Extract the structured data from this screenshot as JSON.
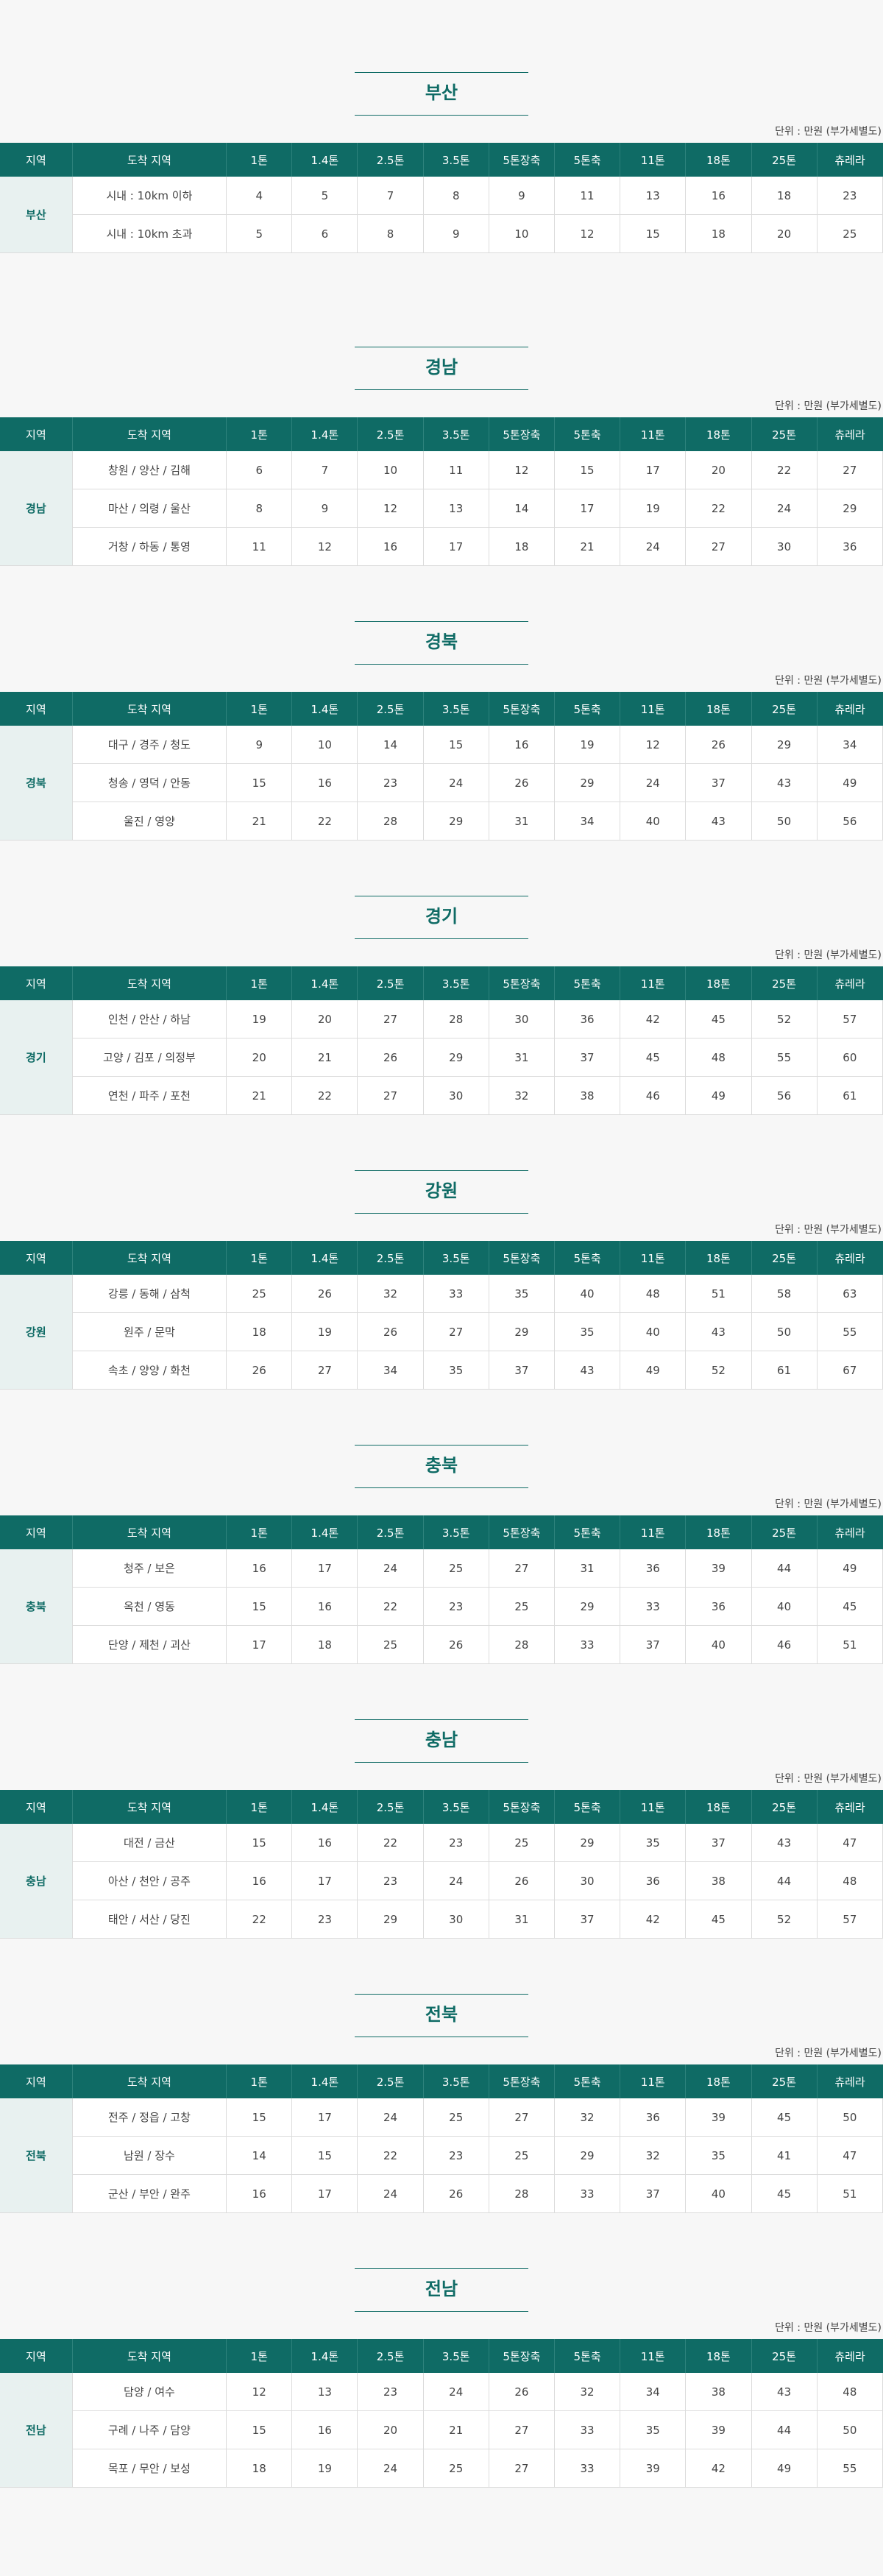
{
  "unit_label": "단위 : 만원 (부가세별도)",
  "headers": [
    "지역",
    "도착 지역",
    "1톤",
    "1.4톤",
    "2.5톤",
    "3.5톤",
    "5톤장축",
    "5톤축",
    "11톤",
    "18톤",
    "25톤",
    "츄레라"
  ],
  "sections": [
    {
      "title": "부산",
      "region": "부산",
      "rows": [
        {
          "dest": "시내 : 10km 이하",
          "values": [
            "4",
            "5",
            "7",
            "8",
            "9",
            "11",
            "13",
            "16",
            "18",
            "23"
          ]
        },
        {
          "dest": "시내 : 10km 초과",
          "values": [
            "5",
            "6",
            "8",
            "9",
            "10",
            "12",
            "15",
            "18",
            "20",
            "25"
          ]
        }
      ]
    },
    {
      "title": "경남",
      "region": "경남",
      "rows": [
        {
          "dest": "창원 / 양산 / 김해",
          "values": [
            "6",
            "7",
            "10",
            "11",
            "12",
            "15",
            "17",
            "20",
            "22",
            "27"
          ]
        },
        {
          "dest": "마산 / 의령 / 울산",
          "values": [
            "8",
            "9",
            "12",
            "13",
            "14",
            "17",
            "19",
            "22",
            "24",
            "29"
          ]
        },
        {
          "dest": "거창 / 하동 / 통영",
          "values": [
            "11",
            "12",
            "16",
            "17",
            "18",
            "21",
            "24",
            "27",
            "30",
            "36"
          ]
        }
      ]
    },
    {
      "title": "경북",
      "region": "경북",
      "rows": [
        {
          "dest": "대구 / 경주 / 청도",
          "values": [
            "9",
            "10",
            "14",
            "15",
            "16",
            "19",
            "12",
            "26",
            "29",
            "34"
          ]
        },
        {
          "dest": "청송 / 영덕 / 안동",
          "values": [
            "15",
            "16",
            "23",
            "24",
            "26",
            "29",
            "24",
            "37",
            "43",
            "49"
          ]
        },
        {
          "dest": "울진 / 영양",
          "values": [
            "21",
            "22",
            "28",
            "29",
            "31",
            "34",
            "40",
            "43",
            "50",
            "56"
          ]
        }
      ]
    },
    {
      "title": "경기",
      "region": "경기",
      "rows": [
        {
          "dest": "인천 / 안산 / 하남",
          "values": [
            "19",
            "20",
            "27",
            "28",
            "30",
            "36",
            "42",
            "45",
            "52",
            "57"
          ]
        },
        {
          "dest": "고양 / 김포 / 의정부",
          "values": [
            "20",
            "21",
            "26",
            "29",
            "31",
            "37",
            "45",
            "48",
            "55",
            "60"
          ]
        },
        {
          "dest": "연천 / 파주 / 포천",
          "values": [
            "21",
            "22",
            "27",
            "30",
            "32",
            "38",
            "46",
            "49",
            "56",
            "61"
          ]
        }
      ]
    },
    {
      "title": "강원",
      "region": "강원",
      "rows": [
        {
          "dest": "강릉 / 동해 / 삼척",
          "values": [
            "25",
            "26",
            "32",
            "33",
            "35",
            "40",
            "48",
            "51",
            "58",
            "63"
          ]
        },
        {
          "dest": "원주 / 문막",
          "values": [
            "18",
            "19",
            "26",
            "27",
            "29",
            "35",
            "40",
            "43",
            "50",
            "55"
          ]
        },
        {
          "dest": "속초 / 양양 / 화천",
          "values": [
            "26",
            "27",
            "34",
            "35",
            "37",
            "43",
            "49",
            "52",
            "61",
            "67"
          ]
        }
      ]
    },
    {
      "title": "충북",
      "region": "충북",
      "rows": [
        {
          "dest": "청주 / 보은",
          "values": [
            "16",
            "17",
            "24",
            "25",
            "27",
            "31",
            "36",
            "39",
            "44",
            "49"
          ]
        },
        {
          "dest": "옥천 / 영동",
          "values": [
            "15",
            "16",
            "22",
            "23",
            "25",
            "29",
            "33",
            "36",
            "40",
            "45"
          ]
        },
        {
          "dest": "단양 / 제천 / 괴산",
          "values": [
            "17",
            "18",
            "25",
            "26",
            "28",
            "33",
            "37",
            "40",
            "46",
            "51"
          ]
        }
      ]
    },
    {
      "title": "충남",
      "region": "충남",
      "rows": [
        {
          "dest": "대전 / 금산",
          "values": [
            "15",
            "16",
            "22",
            "23",
            "25",
            "29",
            "35",
            "37",
            "43",
            "47"
          ]
        },
        {
          "dest": "아산 / 천안 / 공주",
          "values": [
            "16",
            "17",
            "23",
            "24",
            "26",
            "30",
            "36",
            "38",
            "44",
            "48"
          ]
        },
        {
          "dest": "태안 / 서산 / 당진",
          "values": [
            "22",
            "23",
            "29",
            "30",
            "31",
            "37",
            "42",
            "45",
            "52",
            "57"
          ]
        }
      ]
    },
    {
      "title": "전북",
      "region": "전북",
      "rows": [
        {
          "dest": "전주 / 정읍 / 고창",
          "values": [
            "15",
            "17",
            "24",
            "25",
            "27",
            "32",
            "36",
            "39",
            "45",
            "50"
          ]
        },
        {
          "dest": "남원 / 장수",
          "values": [
            "14",
            "15",
            "22",
            "23",
            "25",
            "29",
            "32",
            "35",
            "41",
            "47"
          ]
        },
        {
          "dest": "군산 / 부안 / 완주",
          "values": [
            "16",
            "17",
            "24",
            "26",
            "28",
            "33",
            "37",
            "40",
            "45",
            "51"
          ]
        }
      ]
    },
    {
      "title": "전남",
      "region": "전남",
      "rows": [
        {
          "dest": "담양 / 여수",
          "values": [
            "12",
            "13",
            "23",
            "24",
            "26",
            "32",
            "34",
            "38",
            "43",
            "48"
          ]
        },
        {
          "dest": "구례 / 나주 / 담양",
          "values": [
            "15",
            "16",
            "20",
            "21",
            "27",
            "33",
            "35",
            "39",
            "44",
            "50"
          ]
        },
        {
          "dest": "목포 / 무안 / 보성",
          "values": [
            "18",
            "19",
            "24",
            "25",
            "27",
            "33",
            "39",
            "42",
            "49",
            "55"
          ]
        }
      ]
    }
  ]
}
